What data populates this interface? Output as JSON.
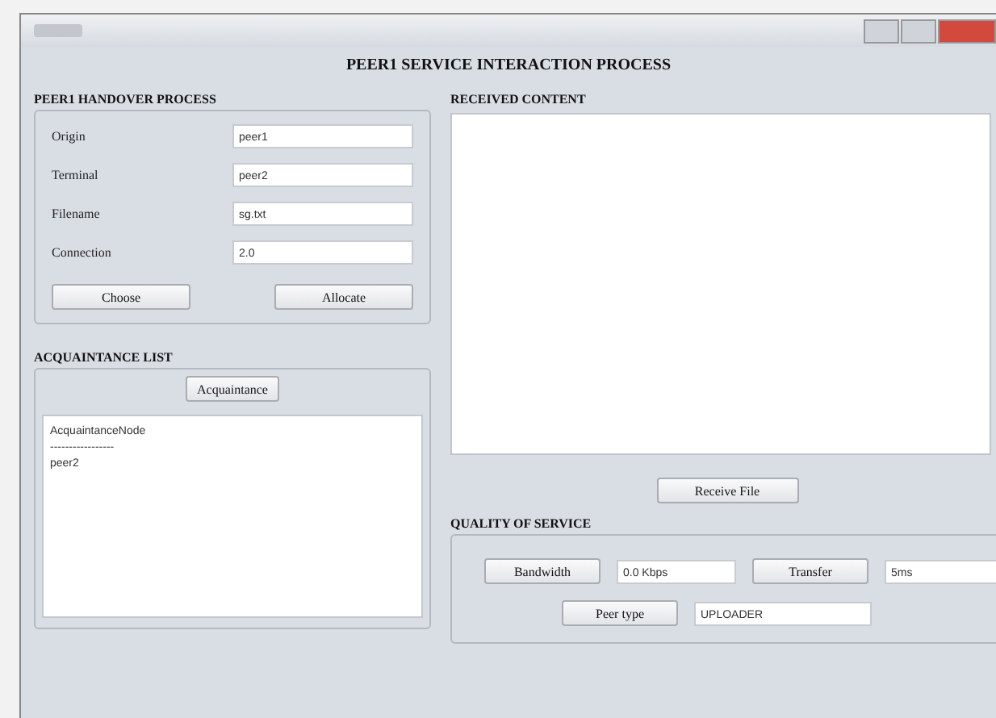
{
  "window": {
    "title": "PEER1 SERVICE INTERACTION PROCESS"
  },
  "handover": {
    "title": "PEER1 HANDOVER PROCESS",
    "fields": [
      {
        "label": "Origin",
        "value": "peer1"
      },
      {
        "label": "Terminal",
        "value": "peer2"
      },
      {
        "label": "Filename",
        "value": "sg.txt"
      },
      {
        "label": "Connection",
        "value": "2.0"
      }
    ],
    "buttons": [
      "Choose",
      "Allocate"
    ]
  },
  "acquaintance": {
    "title": "ACQUAINTANCE LIST",
    "button": "Acquaintance",
    "items": [
      "AcquaintanceNode",
      "-----------------",
      "peer2"
    ]
  },
  "received": {
    "title": "RECEIVED CONTENT",
    "button": "Receive File"
  },
  "qos": {
    "title": "QUALITY OF SERVICE",
    "rows": [
      [
        {
          "button": "Bandwidth",
          "value": "0.0 Kbps"
        },
        {
          "button": "Transfer",
          "value": "5ms"
        }
      ],
      [
        {
          "button": "Peer type",
          "value": "UPLOADER"
        }
      ]
    ]
  }
}
